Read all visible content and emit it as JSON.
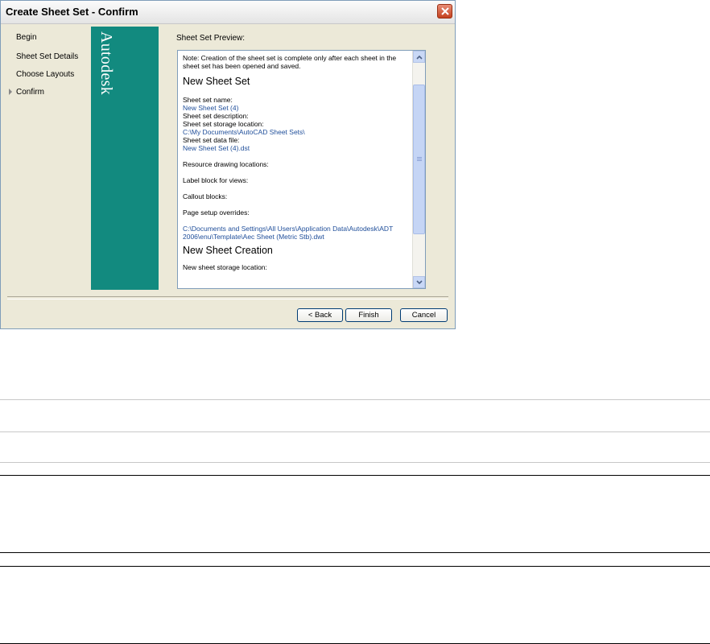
{
  "window": {
    "title": "Create Sheet Set - Confirm"
  },
  "nav": {
    "items": [
      {
        "label": "Begin",
        "current": false
      },
      {
        "label": "Sheet Set Details",
        "current": false
      },
      {
        "label": "Choose Layouts",
        "current": false
      },
      {
        "label": "Confirm",
        "current": true
      }
    ]
  },
  "banner": {
    "logo_text": "Autodesk",
    "color": "#128a7f"
  },
  "preview": {
    "label": "Sheet Set Preview:",
    "note": "Note: Creation of the sheet set is complete only after each sheet in the sheet set has been opened and saved.",
    "heading1": "New Sheet Set",
    "name_label": "Sheet set name:",
    "name_value": "New Sheet Set (4)",
    "desc_label": "Sheet set description:",
    "storage_label": "Sheet set storage location:",
    "storage_value": "C:\\My Documents\\AutoCAD Sheet Sets\\",
    "datafile_label": "Sheet set data file:",
    "datafile_value": "New Sheet Set (4).dst",
    "resource_label": "Resource drawing locations:",
    "labelblock_label": "Label block for views:",
    "callout_label": "Callout blocks:",
    "pagesetup_label": "Page setup overrides:",
    "pagesetup_value": "C:\\Documents and Settings\\All Users\\Application Data\\Autodesk\\ADT 2006\\enu\\Template\\Aec Sheet (Metric Stb).dwt",
    "heading2": "New Sheet Creation",
    "newsheet_storage_label": "New sheet storage location:"
  },
  "buttons": {
    "back": "< Back",
    "finish": "Finish",
    "cancel": "Cancel"
  },
  "colors": {
    "link": "#1f4e9a",
    "dialog_bg": "#ece9d8"
  }
}
